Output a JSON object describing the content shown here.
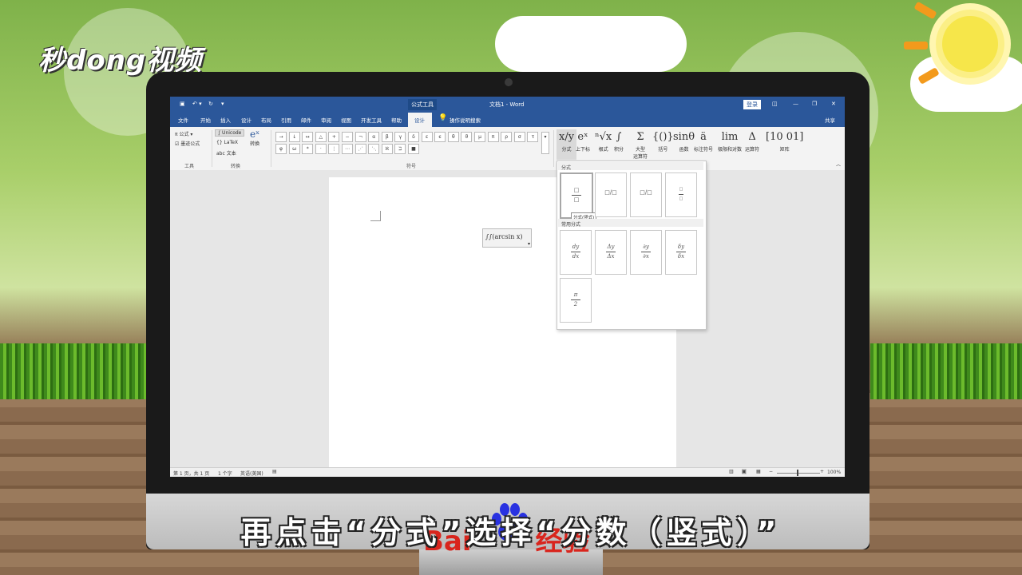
{
  "watermark": {
    "brand": "秒dong视频",
    "baidu_text": "Bai",
    "baidu_suffix": "经验"
  },
  "subtitle": "再点击“分式”选择“分数（竖式）”",
  "window": {
    "context_tab": "公式工具",
    "title": "文档1 - Word",
    "login": "登录"
  },
  "menu": {
    "items": [
      "文件",
      "开始",
      "插入",
      "设计",
      "布局",
      "引用",
      "邮件",
      "审阅",
      "视图",
      "开发工具",
      "帮助"
    ],
    "active": "设计",
    "tell_me": "操作说明搜索",
    "share": "共享"
  },
  "ribbon": {
    "tools": {
      "equation": "π 公式 ▾",
      "ink": "墨迹公式",
      "label": "工具"
    },
    "convert": {
      "unicode": "Unicode",
      "latex": "LaTeX",
      "text": "abc 文本",
      "convert": "转换",
      "label": "转换"
    },
    "symbols": {
      "label": "符号",
      "row1": [
        "→",
        "↓",
        "↔",
        "△",
        "+",
        "−",
        "¬",
        "α",
        "β",
        "γ",
        "δ",
        "ε",
        "ϵ",
        "θ",
        "ϑ",
        "μ",
        "π",
        "ρ",
        "σ",
        "τ"
      ],
      "row2": [
        "φ",
        "ω",
        "*",
        "·",
        "⋮",
        "⋯",
        "⋰",
        "⋱",
        "ℵ",
        "ℶ",
        "■"
      ]
    },
    "structures": [
      {
        "glyph": "x/y",
        "label": "分式"
      },
      {
        "glyph": "eˣ",
        "label": "上下标"
      },
      {
        "glyph": "ⁿ√x",
        "label": "根式"
      },
      {
        "glyph": "∫",
        "label": "积分"
      },
      {
        "glyph": "Σ",
        "label": "大型\n运算符"
      },
      {
        "glyph": "{()}",
        "label": "括号"
      },
      {
        "glyph": "sinθ",
        "label": "函数"
      },
      {
        "glyph": "ä",
        "label": "标注符号"
      },
      {
        "glyph": "lim",
        "label": "极限和对数"
      },
      {
        "glyph": "Δ",
        "label": "运算符"
      },
      {
        "glyph": "[10 01]",
        "label": "矩阵"
      }
    ]
  },
  "document": {
    "equation_text": "∫∫(arcsin x)"
  },
  "dropdown": {
    "section1": "分式",
    "section2": "常用分式",
    "tooltip": "分式(竖式)",
    "common": [
      {
        "num": "dy",
        "den": "dx"
      },
      {
        "num": "Δy",
        "den": "Δx"
      },
      {
        "num": "∂y",
        "den": "∂x"
      },
      {
        "num": "δy",
        "den": "δx"
      },
      {
        "num": "π",
        "den": "2"
      }
    ]
  },
  "status": {
    "page": "第 1 页，共 1 页",
    "words": "1 个字",
    "lang": "英语(美国)",
    "zoom": "100%"
  }
}
